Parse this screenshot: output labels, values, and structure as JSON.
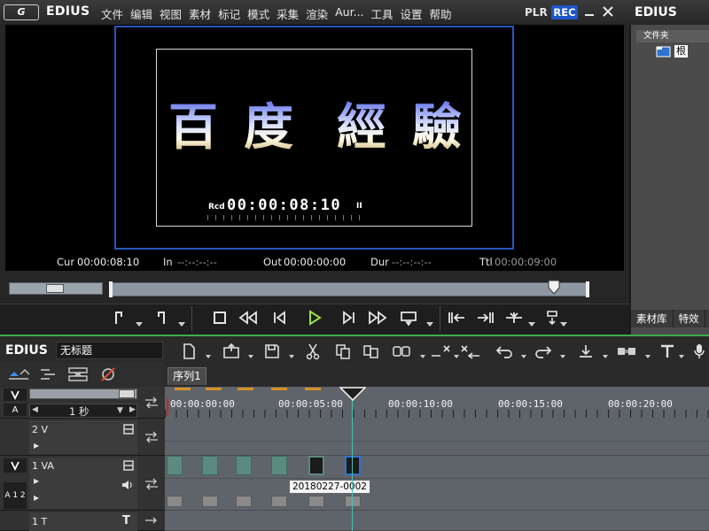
{
  "app": {
    "logo": "G",
    "brand": "EDIUS"
  },
  "menu": [
    "文件",
    "编辑",
    "视图",
    "素材",
    "标记",
    "模式",
    "采集",
    "渲染",
    "Aur...",
    "工具",
    "设置",
    "帮助"
  ],
  "player": {
    "plr_label": "PLR",
    "rec_label": "REC",
    "title_chars": [
      "百",
      "度",
      "經",
      "驗"
    ],
    "rcd_label": "Rcd",
    "rcd_timecode": "00:00:08:10",
    "rcd_suffix": "II",
    "timecodes": {
      "cur_label": "Cur",
      "cur_value": "00:00:08:10",
      "in_label": "In",
      "in_value": "--:--:--:--",
      "out_label": "Out",
      "out_value": "00:00:00:00",
      "dur_label": "Dur",
      "dur_value": "--:--:--:--",
      "ttl_label": "Ttl",
      "ttl_value": "00:00:09:00"
    }
  },
  "bin": {
    "brand": "EDIUS",
    "folder_header": "文件夹",
    "root_label": "根",
    "tabs": [
      "素材库",
      "特效"
    ]
  },
  "timeline": {
    "brand": "EDIUS",
    "project_name": "无标题",
    "sequence_tab": "序列1",
    "zoom_value": "1 秒",
    "ruler_labels": [
      "00:00:00:00",
      "00:00:05:00",
      "00:00:10:00",
      "00:00:15:00",
      "00:00:20:00"
    ],
    "tracks": [
      {
        "name": "2 V"
      },
      {
        "name": "1 VA",
        "aux": "A 1 2"
      },
      {
        "name": "1 T"
      }
    ],
    "track_header_icons": {
      "v_toggle": "V",
      "a_toggle": "A",
      "t_icon": "T"
    },
    "clip_label": "20180227-0002"
  },
  "colors": {
    "safe_frame": "#2b55c0",
    "rec_badge": "#1e55c8",
    "divider": "#3cae4a",
    "clip": "#5d8a7f",
    "playhead": "#4cc0b0"
  }
}
